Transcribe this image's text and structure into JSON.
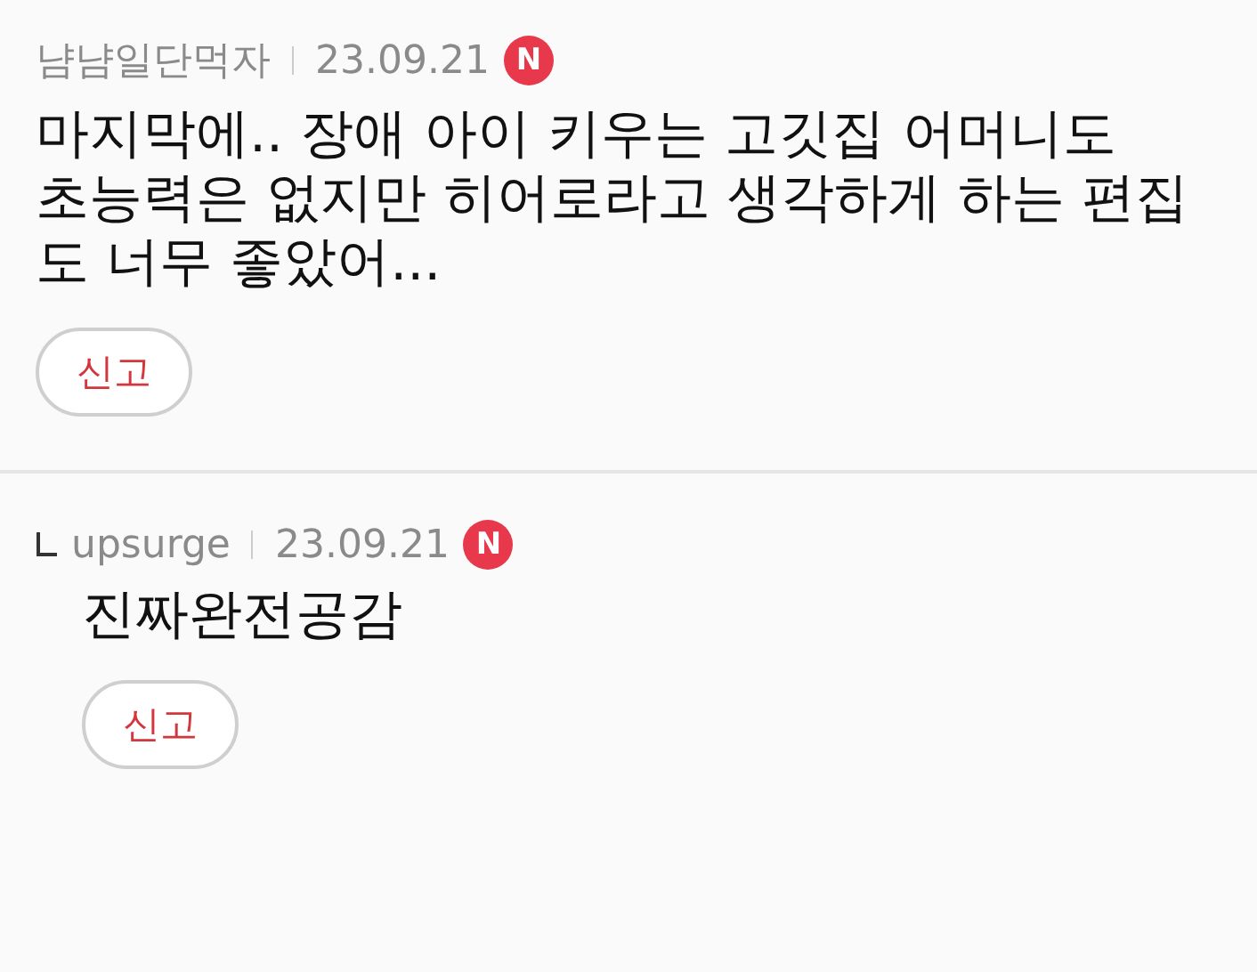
{
  "comments": [
    {
      "kind": "comment",
      "author": "냠냠일단먹자",
      "date": "23.09.21",
      "badge": "N",
      "text": "마지막에.. 장애 아이 키우는 고깃집 어머니도\n초능력은 없지만 히어로라고 생각하게 하는 편집도 너무 좋았어...",
      "report_label": "신고"
    },
    {
      "kind": "reply",
      "author": "upsurge",
      "date": "23.09.21",
      "badge": "N",
      "text": "진짜완전공감",
      "report_label": "신고"
    }
  ]
}
